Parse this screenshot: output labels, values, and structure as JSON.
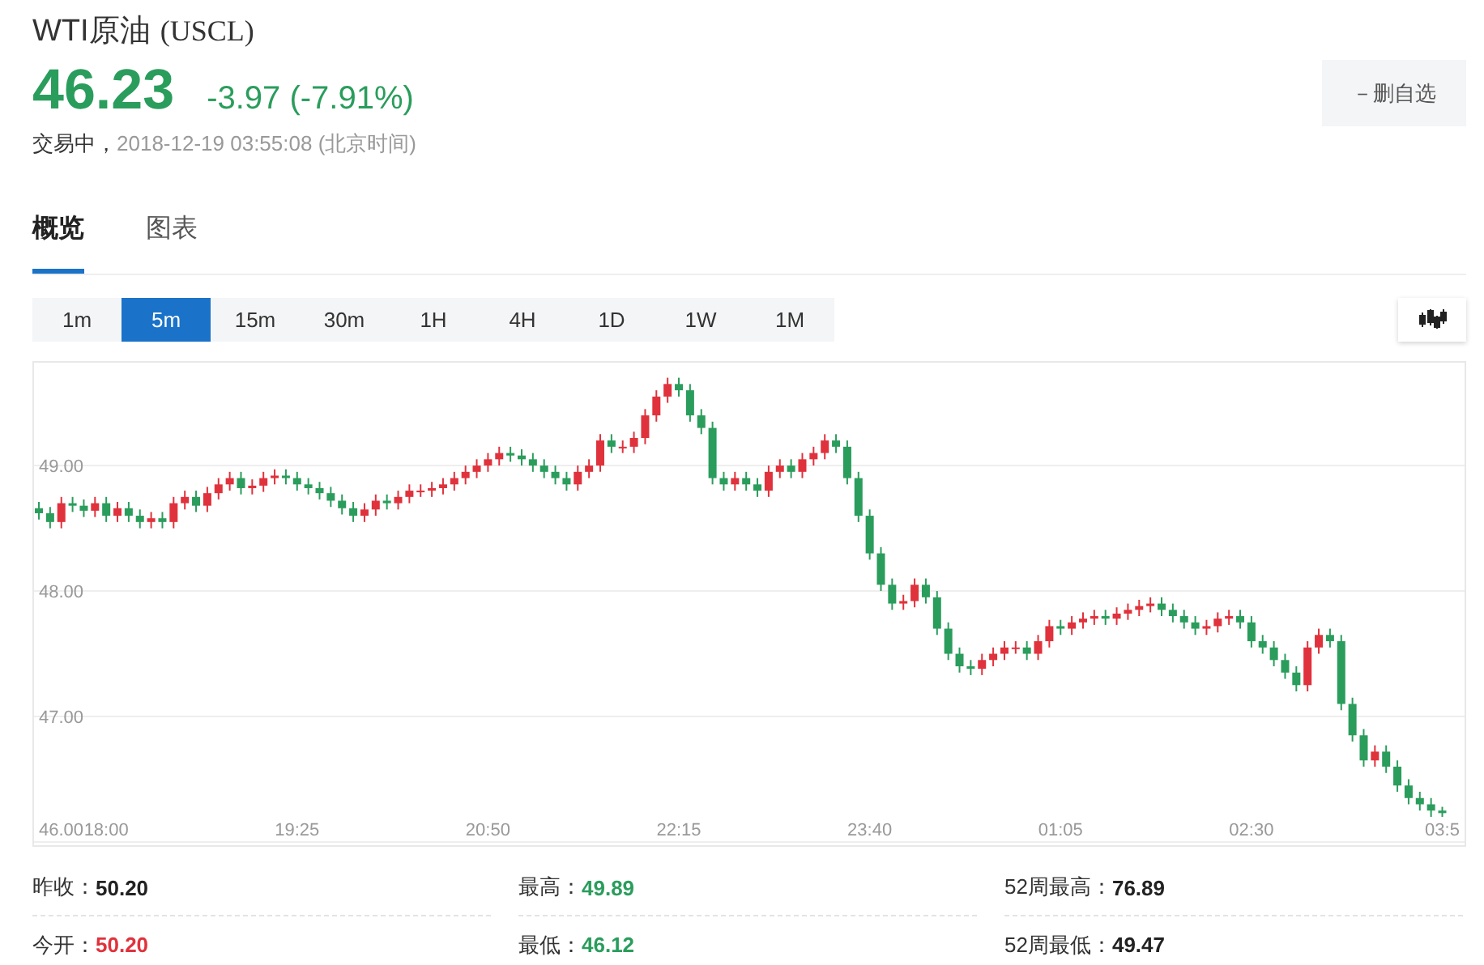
{
  "header": {
    "name": "WTI原油",
    "code": "(USCL)",
    "price": "46.23",
    "change": "-3.97 (-7.91%)",
    "status": "交易中，",
    "time": "2018-12-19 03:55:08 (北京时间)",
    "watch_button": "－删自选"
  },
  "tabs": [
    {
      "label": "概览",
      "selected": true
    },
    {
      "label": "图表",
      "selected": false
    }
  ],
  "periods": [
    {
      "label": "1m",
      "selected": false
    },
    {
      "label": "5m",
      "selected": true
    },
    {
      "label": "15m",
      "selected": false
    },
    {
      "label": "30m",
      "selected": false
    },
    {
      "label": "1H",
      "selected": false
    },
    {
      "label": "4H",
      "selected": false
    },
    {
      "label": "1D",
      "selected": false
    },
    {
      "label": "1W",
      "selected": false
    },
    {
      "label": "1M",
      "selected": false
    }
  ],
  "chart": {
    "chart_data": {
      "type": "candlestick",
      "ylim": [
        46,
        49.82
      ],
      "grid": true,
      "categories": [
        null,
        null,
        null,
        null,
        null,
        null,
        "18:00",
        null,
        null,
        null,
        null,
        null,
        null,
        null,
        null,
        null,
        null,
        null,
        null,
        null,
        null,
        null,
        null,
        "19:25",
        null,
        null,
        null,
        null,
        null,
        null,
        null,
        null,
        null,
        null,
        null,
        null,
        null,
        null,
        null,
        null,
        "20:50",
        null,
        null,
        null,
        null,
        null,
        null,
        null,
        null,
        null,
        null,
        null,
        null,
        null,
        null,
        null,
        null,
        "22:15",
        null,
        null,
        null,
        null,
        null,
        null,
        null,
        null,
        null,
        null,
        null,
        null,
        null,
        null,
        null,
        null,
        "23:40",
        null,
        null,
        null,
        null,
        null,
        null,
        null,
        null,
        null,
        null,
        null,
        null,
        null,
        null,
        null,
        null,
        "01:05",
        null,
        null,
        null,
        null,
        null,
        null,
        null,
        null,
        null,
        null,
        null,
        null,
        null,
        null,
        null,
        null,
        "02:30",
        null,
        null,
        null,
        null,
        null,
        null,
        null,
        null,
        null,
        null,
        null,
        null,
        null,
        null,
        null,
        null,
        "03:5"
      ],
      "ohlc": [
        [
          48.66,
          48.71,
          48.57,
          48.62
        ],
        [
          48.62,
          48.67,
          48.5,
          48.55
        ],
        [
          48.55,
          48.75,
          48.5,
          48.7
        ],
        [
          48.7,
          48.75,
          48.63,
          48.68
        ],
        [
          48.68,
          48.73,
          48.59,
          48.64
        ],
        [
          48.64,
          48.75,
          48.59,
          48.7
        ],
        [
          48.7,
          48.75,
          48.55,
          48.6
        ],
        [
          48.6,
          48.71,
          48.55,
          48.66
        ],
        [
          48.66,
          48.71,
          48.55,
          48.6
        ],
        [
          48.6,
          48.65,
          48.5,
          48.55
        ],
        [
          48.55,
          48.63,
          48.5,
          48.58
        ],
        [
          48.58,
          48.63,
          48.5,
          48.55
        ],
        [
          48.55,
          48.75,
          48.5,
          48.7
        ],
        [
          48.7,
          48.8,
          48.65,
          48.75
        ],
        [
          48.75,
          48.8,
          48.63,
          48.68
        ],
        [
          48.68,
          48.83,
          48.63,
          48.78
        ],
        [
          48.78,
          48.9,
          48.73,
          48.85
        ],
        [
          48.85,
          48.95,
          48.8,
          48.9
        ],
        [
          48.9,
          48.95,
          48.77,
          48.82
        ],
        [
          48.82,
          48.89,
          48.77,
          48.84
        ],
        [
          48.84,
          48.95,
          48.79,
          48.9
        ],
        [
          48.9,
          48.97,
          48.85,
          48.92
        ],
        [
          48.92,
          48.97,
          48.85,
          48.9
        ],
        [
          48.9,
          48.95,
          48.8,
          48.85
        ],
        [
          48.85,
          48.9,
          48.77,
          48.82
        ],
        [
          48.82,
          48.87,
          48.73,
          48.78
        ],
        [
          48.78,
          48.83,
          48.67,
          48.72
        ],
        [
          48.72,
          48.77,
          48.61,
          48.66
        ],
        [
          48.66,
          48.71,
          48.55,
          48.6
        ],
        [
          48.6,
          48.7,
          48.55,
          48.65
        ],
        [
          48.65,
          48.77,
          48.6,
          48.72
        ],
        [
          48.72,
          48.77,
          48.65,
          48.7
        ],
        [
          48.7,
          48.8,
          48.65,
          48.75
        ],
        [
          48.75,
          48.85,
          48.7,
          48.8
        ],
        [
          48.8,
          48.85,
          48.75,
          48.8
        ],
        [
          48.8,
          48.87,
          48.75,
          48.82
        ],
        [
          48.82,
          48.9,
          48.77,
          48.85
        ],
        [
          48.85,
          48.95,
          48.8,
          48.9
        ],
        [
          48.9,
          49.0,
          48.85,
          48.95
        ],
        [
          48.95,
          49.05,
          48.9,
          49.0
        ],
        [
          49.0,
          49.1,
          48.95,
          49.05
        ],
        [
          49.05,
          49.15,
          49.0,
          49.1
        ],
        [
          49.1,
          49.15,
          49.03,
          49.08
        ],
        [
          49.08,
          49.13,
          49.0,
          49.05
        ],
        [
          49.05,
          49.1,
          48.95,
          49.0
        ],
        [
          49.0,
          49.05,
          48.9,
          48.95
        ],
        [
          48.95,
          49.0,
          48.85,
          48.9
        ],
        [
          48.9,
          48.95,
          48.8,
          48.85
        ],
        [
          48.85,
          49.0,
          48.8,
          48.95
        ],
        [
          48.95,
          49.05,
          48.9,
          49.0
        ],
        [
          49.0,
          49.25,
          48.95,
          49.2
        ],
        [
          49.2,
          49.25,
          49.1,
          49.15
        ],
        [
          49.15,
          49.2,
          49.1,
          49.15
        ],
        [
          49.15,
          49.27,
          49.1,
          49.22
        ],
        [
          49.22,
          49.45,
          49.17,
          49.4
        ],
        [
          49.4,
          49.6,
          49.35,
          49.55
        ],
        [
          49.55,
          49.7,
          49.5,
          49.65
        ],
        [
          49.65,
          49.7,
          49.55,
          49.6
        ],
        [
          49.6,
          49.65,
          49.35,
          49.4
        ],
        [
          49.4,
          49.45,
          49.25,
          49.3
        ],
        [
          49.3,
          49.35,
          48.85,
          48.9
        ],
        [
          48.9,
          48.95,
          48.8,
          48.85
        ],
        [
          48.85,
          48.95,
          48.8,
          48.9
        ],
        [
          48.9,
          48.95,
          48.8,
          48.85
        ],
        [
          48.85,
          48.9,
          48.75,
          48.8
        ],
        [
          48.8,
          49.0,
          48.75,
          48.95
        ],
        [
          48.95,
          49.05,
          48.9,
          49.0
        ],
        [
          49.0,
          49.05,
          48.9,
          48.95
        ],
        [
          48.95,
          49.1,
          48.9,
          49.05
        ],
        [
          49.05,
          49.15,
          49.0,
          49.1
        ],
        [
          49.1,
          49.25,
          49.05,
          49.2
        ],
        [
          49.2,
          49.25,
          49.1,
          49.15
        ],
        [
          49.15,
          49.2,
          48.85,
          48.9
        ],
        [
          48.9,
          48.95,
          48.55,
          48.6
        ],
        [
          48.6,
          48.65,
          48.25,
          48.3
        ],
        [
          48.3,
          48.35,
          48.0,
          48.05
        ],
        [
          48.05,
          48.1,
          47.85,
          47.9
        ],
        [
          47.9,
          47.97,
          47.85,
          47.92
        ],
        [
          47.92,
          48.1,
          47.87,
          48.05
        ],
        [
          48.05,
          48.1,
          47.9,
          47.95
        ],
        [
          47.95,
          48.0,
          47.65,
          47.7
        ],
        [
          47.7,
          47.75,
          47.45,
          47.5
        ],
        [
          47.5,
          47.55,
          47.35,
          47.4
        ],
        [
          47.4,
          47.45,
          47.33,
          47.38
        ],
        [
          47.38,
          47.5,
          47.33,
          47.45
        ],
        [
          47.45,
          47.55,
          47.4,
          47.5
        ],
        [
          47.5,
          47.6,
          47.45,
          47.55
        ],
        [
          47.55,
          47.6,
          47.5,
          47.55
        ],
        [
          47.55,
          47.6,
          47.45,
          47.5
        ],
        [
          47.5,
          47.65,
          47.45,
          47.6
        ],
        [
          47.6,
          47.77,
          47.55,
          47.72
        ],
        [
          47.72,
          47.77,
          47.65,
          47.7
        ],
        [
          47.7,
          47.8,
          47.65,
          47.75
        ],
        [
          47.75,
          47.83,
          47.7,
          47.78
        ],
        [
          47.78,
          47.85,
          47.73,
          47.8
        ],
        [
          47.8,
          47.85,
          47.73,
          47.78
        ],
        [
          47.78,
          47.87,
          47.73,
          47.82
        ],
        [
          47.82,
          47.9,
          47.77,
          47.85
        ],
        [
          47.85,
          47.93,
          47.8,
          47.88
        ],
        [
          47.88,
          47.95,
          47.83,
          47.9
        ],
        [
          47.9,
          47.95,
          47.8,
          47.85
        ],
        [
          47.85,
          47.9,
          47.75,
          47.8
        ],
        [
          47.8,
          47.85,
          47.7,
          47.75
        ],
        [
          47.75,
          47.8,
          47.65,
          47.7
        ],
        [
          47.7,
          47.77,
          47.65,
          47.72
        ],
        [
          47.72,
          47.83,
          47.67,
          47.78
        ],
        [
          47.78,
          47.85,
          47.73,
          47.8
        ],
        [
          47.8,
          47.85,
          47.7,
          47.75
        ],
        [
          47.75,
          47.8,
          47.55,
          47.6
        ],
        [
          47.6,
          47.65,
          47.5,
          47.55
        ],
        [
          47.55,
          47.6,
          47.4,
          47.45
        ],
        [
          47.45,
          47.5,
          47.3,
          47.35
        ],
        [
          47.35,
          47.4,
          47.2,
          47.25
        ],
        [
          47.25,
          47.6,
          47.2,
          47.55
        ],
        [
          47.55,
          47.7,
          47.5,
          47.65
        ],
        [
          47.65,
          47.7,
          47.55,
          47.6
        ],
        [
          47.6,
          47.65,
          47.05,
          47.1
        ],
        [
          47.1,
          47.15,
          46.8,
          46.85
        ],
        [
          46.85,
          46.9,
          46.6,
          46.65
        ],
        [
          46.65,
          46.77,
          46.6,
          46.72
        ],
        [
          46.72,
          46.77,
          46.55,
          46.6
        ],
        [
          46.6,
          46.65,
          46.4,
          46.45
        ],
        [
          46.45,
          46.5,
          46.3,
          46.35
        ],
        [
          46.35,
          46.4,
          46.25,
          46.3
        ],
        [
          46.3,
          46.35,
          46.2,
          46.25
        ],
        [
          46.25,
          46.28,
          46.2,
          46.23
        ]
      ],
      "yticks": [
        {
          "value": 46,
          "label": "46.00"
        },
        {
          "value": 47,
          "label": "47.00"
        },
        {
          "value": 48,
          "label": "48.00"
        },
        {
          "value": 49,
          "label": "49.00"
        }
      ]
    }
  },
  "stats": [
    {
      "label": "昨收：",
      "value": "50.20",
      "color": "#222222"
    },
    {
      "label": "最高：",
      "value": "49.89",
      "color": "#2a9d5c"
    },
    {
      "label": "52周最高：",
      "value": "76.89",
      "color": "#222222"
    },
    {
      "label": "今开：",
      "value": "50.20",
      "color": "#e0323c"
    },
    {
      "label": "最低：",
      "value": "46.12",
      "color": "#2a9d5c"
    },
    {
      "label": "52周最低：",
      "value": "49.47",
      "color": "#222222"
    }
  ]
}
